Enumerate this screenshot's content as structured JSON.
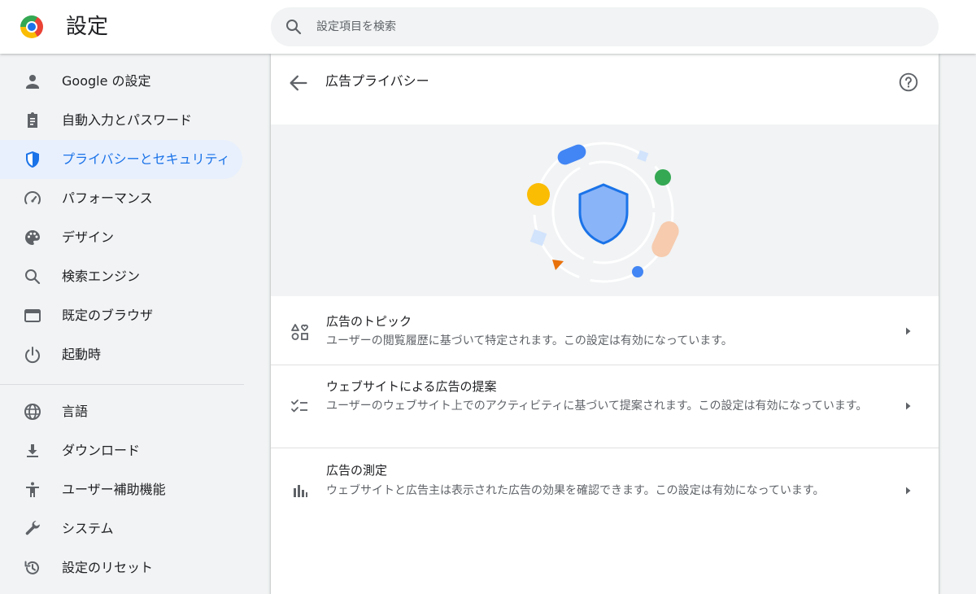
{
  "header": {
    "title": "設定",
    "search_placeholder": "設定項目を検索"
  },
  "sidebar": {
    "items": [
      {
        "label": "Google の設定",
        "icon": "person-icon"
      },
      {
        "label": "自動入力とパスワード",
        "icon": "clipboard-icon"
      },
      {
        "label": "プライバシーとセキュリティ",
        "icon": "shield-icon",
        "active": true
      },
      {
        "label": "パフォーマンス",
        "icon": "speedometer-icon"
      },
      {
        "label": "デザイン",
        "icon": "palette-icon"
      },
      {
        "label": "検索エンジン",
        "icon": "search-icon"
      },
      {
        "label": "既定のブラウザ",
        "icon": "browser-icon"
      },
      {
        "label": "起動時",
        "icon": "power-icon"
      },
      {
        "label": "言語",
        "icon": "globe-icon"
      },
      {
        "label": "ダウンロード",
        "icon": "download-icon"
      },
      {
        "label": "ユーザー補助機能",
        "icon": "accessibility-icon"
      },
      {
        "label": "システム",
        "icon": "wrench-icon"
      },
      {
        "label": "設定のリセット",
        "icon": "reset-icon"
      }
    ]
  },
  "main": {
    "page_title": "広告プライバシー",
    "rows": [
      {
        "title": "広告のトピック",
        "description": "ユーザーの閲覧履歴に基づいて特定されます。この設定は有効になっています。",
        "icon": "topics-icon"
      },
      {
        "title": "ウェブサイトによる広告の提案",
        "description": "ユーザーのウェブサイト上でのアクティビティに基づいて提案されます。この設定は有効になっています。",
        "icon": "checklist-icon"
      },
      {
        "title": "広告の測定",
        "description": "ウェブサイトと広告主は表示された広告の効果を確認できます。この設定は有効になっています。",
        "icon": "bar-chart-icon"
      }
    ]
  },
  "colors": {
    "accent": "#1a73e8",
    "active_bg": "#e8f0fe",
    "text": "#202124",
    "secondary_text": "#5f6368",
    "page_bg": "#f1f3f4"
  }
}
